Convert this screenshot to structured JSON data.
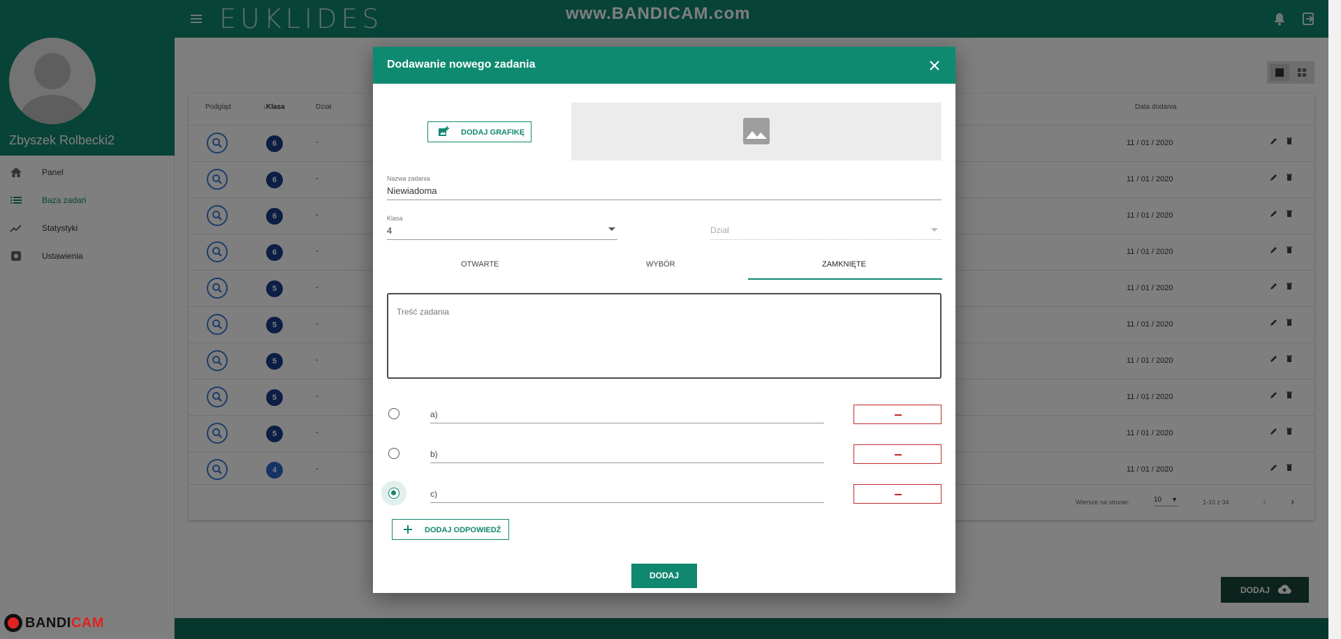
{
  "app": {
    "logo_text": "EUKLIDES",
    "watermark": "www.BANDICAM.com",
    "recorder_brand": "BANDI",
    "recorder_brand_suffix": "CAM"
  },
  "sidebar": {
    "username": "Zbyszek Rolbecki2",
    "items": [
      {
        "label": "Panel",
        "icon": "home-icon"
      },
      {
        "label": "Baza zadań",
        "icon": "list-icon",
        "active": true
      },
      {
        "label": "Statystyki",
        "icon": "trending-icon"
      },
      {
        "label": "Ustawienia",
        "icon": "settings-icon"
      }
    ]
  },
  "table": {
    "headers": {
      "preview": "Podgląd",
      "grade": "Klasa",
      "section": "Dział",
      "date": "Data dodania"
    },
    "rows": [
      {
        "grade": "6",
        "section": "-",
        "date": "11 / 01 / 2020"
      },
      {
        "grade": "6",
        "section": "-",
        "date": "11 / 01 / 2020"
      },
      {
        "grade": "6",
        "section": "-",
        "date": "11 / 01 / 2020"
      },
      {
        "grade": "6",
        "section": "-",
        "date": "11 / 01 / 2020"
      },
      {
        "grade": "5",
        "section": "-",
        "date": "11 / 01 / 2020"
      },
      {
        "grade": "5",
        "section": "-",
        "date": "11 / 01 / 2020"
      },
      {
        "grade": "5",
        "section": "-",
        "date": "11 / 01 / 2020"
      },
      {
        "grade": "5",
        "section": "-",
        "date": "11 / 01 / 2020"
      },
      {
        "grade": "5",
        "section": "-",
        "date": "11 / 01 / 2020"
      },
      {
        "grade": "4",
        "section": "-",
        "date": "11 / 01 / 2020"
      }
    ],
    "pager": {
      "rows_label": "Wiersze na stronie:",
      "rows_value": "10",
      "range": "1-10 z 34"
    }
  },
  "main_add_button": "DODAJ",
  "dialog": {
    "title": "Dodawanie nowego zadania",
    "add_image_label": "DODAJ GRAFIKĘ",
    "name_label": "Nazwa zadania",
    "name_value": "Niewiadoma",
    "grade_label": "Klasa",
    "grade_value": "4",
    "section_placeholder": "Dział",
    "tabs": [
      "OTWARTE",
      "WYBÓR",
      "ZAMKNIĘTE"
    ],
    "active_tab": "ZAMKNIĘTE",
    "content_placeholder": "Treść zadania",
    "answers": [
      {
        "letter": "a)",
        "checked": false
      },
      {
        "letter": "b)",
        "checked": false
      },
      {
        "letter": "c)",
        "checked": true
      }
    ],
    "add_answer_label": "DODAJ ODPOWIEDŹ",
    "submit_label": "DODAJ"
  },
  "colors": {
    "primary": "#10876f",
    "danger": "#c62828",
    "grade_badge": "#1a3d8a"
  }
}
